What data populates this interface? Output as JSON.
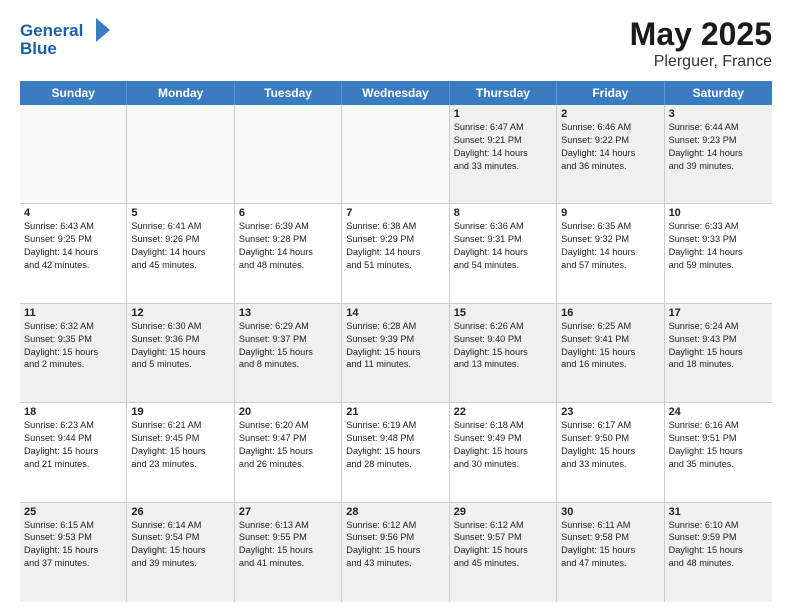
{
  "header": {
    "logo_text_general": "General",
    "logo_text_blue": "Blue",
    "month_title": "May 2025",
    "location": "Plerguer, France"
  },
  "days_of_week": [
    "Sunday",
    "Monday",
    "Tuesday",
    "Wednesday",
    "Thursday",
    "Friday",
    "Saturday"
  ],
  "weeks": [
    [
      {
        "day": "",
        "empty": true
      },
      {
        "day": "",
        "empty": true
      },
      {
        "day": "",
        "empty": true
      },
      {
        "day": "",
        "empty": true
      },
      {
        "day": "1",
        "lines": [
          "Sunrise: 6:47 AM",
          "Sunset: 9:21 PM",
          "Daylight: 14 hours",
          "and 33 minutes."
        ]
      },
      {
        "day": "2",
        "lines": [
          "Sunrise: 6:46 AM",
          "Sunset: 9:22 PM",
          "Daylight: 14 hours",
          "and 36 minutes."
        ]
      },
      {
        "day": "3",
        "lines": [
          "Sunrise: 6:44 AM",
          "Sunset: 9:23 PM",
          "Daylight: 14 hours",
          "and 39 minutes."
        ]
      }
    ],
    [
      {
        "day": "4",
        "lines": [
          "Sunrise: 6:43 AM",
          "Sunset: 9:25 PM",
          "Daylight: 14 hours",
          "and 42 minutes."
        ]
      },
      {
        "day": "5",
        "lines": [
          "Sunrise: 6:41 AM",
          "Sunset: 9:26 PM",
          "Daylight: 14 hours",
          "and 45 minutes."
        ]
      },
      {
        "day": "6",
        "lines": [
          "Sunrise: 6:39 AM",
          "Sunset: 9:28 PM",
          "Daylight: 14 hours",
          "and 48 minutes."
        ]
      },
      {
        "day": "7",
        "lines": [
          "Sunrise: 6:38 AM",
          "Sunset: 9:29 PM",
          "Daylight: 14 hours",
          "and 51 minutes."
        ]
      },
      {
        "day": "8",
        "lines": [
          "Sunrise: 6:36 AM",
          "Sunset: 9:31 PM",
          "Daylight: 14 hours",
          "and 54 minutes."
        ]
      },
      {
        "day": "9",
        "lines": [
          "Sunrise: 6:35 AM",
          "Sunset: 9:32 PM",
          "Daylight: 14 hours",
          "and 57 minutes."
        ]
      },
      {
        "day": "10",
        "lines": [
          "Sunrise: 6:33 AM",
          "Sunset: 9:33 PM",
          "Daylight: 14 hours",
          "and 59 minutes."
        ]
      }
    ],
    [
      {
        "day": "11",
        "lines": [
          "Sunrise: 6:32 AM",
          "Sunset: 9:35 PM",
          "Daylight: 15 hours",
          "and 2 minutes."
        ]
      },
      {
        "day": "12",
        "lines": [
          "Sunrise: 6:30 AM",
          "Sunset: 9:36 PM",
          "Daylight: 15 hours",
          "and 5 minutes."
        ]
      },
      {
        "day": "13",
        "lines": [
          "Sunrise: 6:29 AM",
          "Sunset: 9:37 PM",
          "Daylight: 15 hours",
          "and 8 minutes."
        ]
      },
      {
        "day": "14",
        "lines": [
          "Sunrise: 6:28 AM",
          "Sunset: 9:39 PM",
          "Daylight: 15 hours",
          "and 11 minutes."
        ]
      },
      {
        "day": "15",
        "lines": [
          "Sunrise: 6:26 AM",
          "Sunset: 9:40 PM",
          "Daylight: 15 hours",
          "and 13 minutes."
        ]
      },
      {
        "day": "16",
        "lines": [
          "Sunrise: 6:25 AM",
          "Sunset: 9:41 PM",
          "Daylight: 15 hours",
          "and 16 minutes."
        ]
      },
      {
        "day": "17",
        "lines": [
          "Sunrise: 6:24 AM",
          "Sunset: 9:43 PM",
          "Daylight: 15 hours",
          "and 18 minutes."
        ]
      }
    ],
    [
      {
        "day": "18",
        "lines": [
          "Sunrise: 6:23 AM",
          "Sunset: 9:44 PM",
          "Daylight: 15 hours",
          "and 21 minutes."
        ]
      },
      {
        "day": "19",
        "lines": [
          "Sunrise: 6:21 AM",
          "Sunset: 9:45 PM",
          "Daylight: 15 hours",
          "and 23 minutes."
        ]
      },
      {
        "day": "20",
        "lines": [
          "Sunrise: 6:20 AM",
          "Sunset: 9:47 PM",
          "Daylight: 15 hours",
          "and 26 minutes."
        ]
      },
      {
        "day": "21",
        "lines": [
          "Sunrise: 6:19 AM",
          "Sunset: 9:48 PM",
          "Daylight: 15 hours",
          "and 28 minutes."
        ]
      },
      {
        "day": "22",
        "lines": [
          "Sunrise: 6:18 AM",
          "Sunset: 9:49 PM",
          "Daylight: 15 hours",
          "and 30 minutes."
        ]
      },
      {
        "day": "23",
        "lines": [
          "Sunrise: 6:17 AM",
          "Sunset: 9:50 PM",
          "Daylight: 15 hours",
          "and 33 minutes."
        ]
      },
      {
        "day": "24",
        "lines": [
          "Sunrise: 6:16 AM",
          "Sunset: 9:51 PM",
          "Daylight: 15 hours",
          "and 35 minutes."
        ]
      }
    ],
    [
      {
        "day": "25",
        "lines": [
          "Sunrise: 6:15 AM",
          "Sunset: 9:53 PM",
          "Daylight: 15 hours",
          "and 37 minutes."
        ]
      },
      {
        "day": "26",
        "lines": [
          "Sunrise: 6:14 AM",
          "Sunset: 9:54 PM",
          "Daylight: 15 hours",
          "and 39 minutes."
        ]
      },
      {
        "day": "27",
        "lines": [
          "Sunrise: 6:13 AM",
          "Sunset: 9:55 PM",
          "Daylight: 15 hours",
          "and 41 minutes."
        ]
      },
      {
        "day": "28",
        "lines": [
          "Sunrise: 6:12 AM",
          "Sunset: 9:56 PM",
          "Daylight: 15 hours",
          "and 43 minutes."
        ]
      },
      {
        "day": "29",
        "lines": [
          "Sunrise: 6:12 AM",
          "Sunset: 9:57 PM",
          "Daylight: 15 hours",
          "and 45 minutes."
        ]
      },
      {
        "day": "30",
        "lines": [
          "Sunrise: 6:11 AM",
          "Sunset: 9:58 PM",
          "Daylight: 15 hours",
          "and 47 minutes."
        ]
      },
      {
        "day": "31",
        "lines": [
          "Sunrise: 6:10 AM",
          "Sunset: 9:59 PM",
          "Daylight: 15 hours",
          "and 48 minutes."
        ]
      }
    ]
  ]
}
